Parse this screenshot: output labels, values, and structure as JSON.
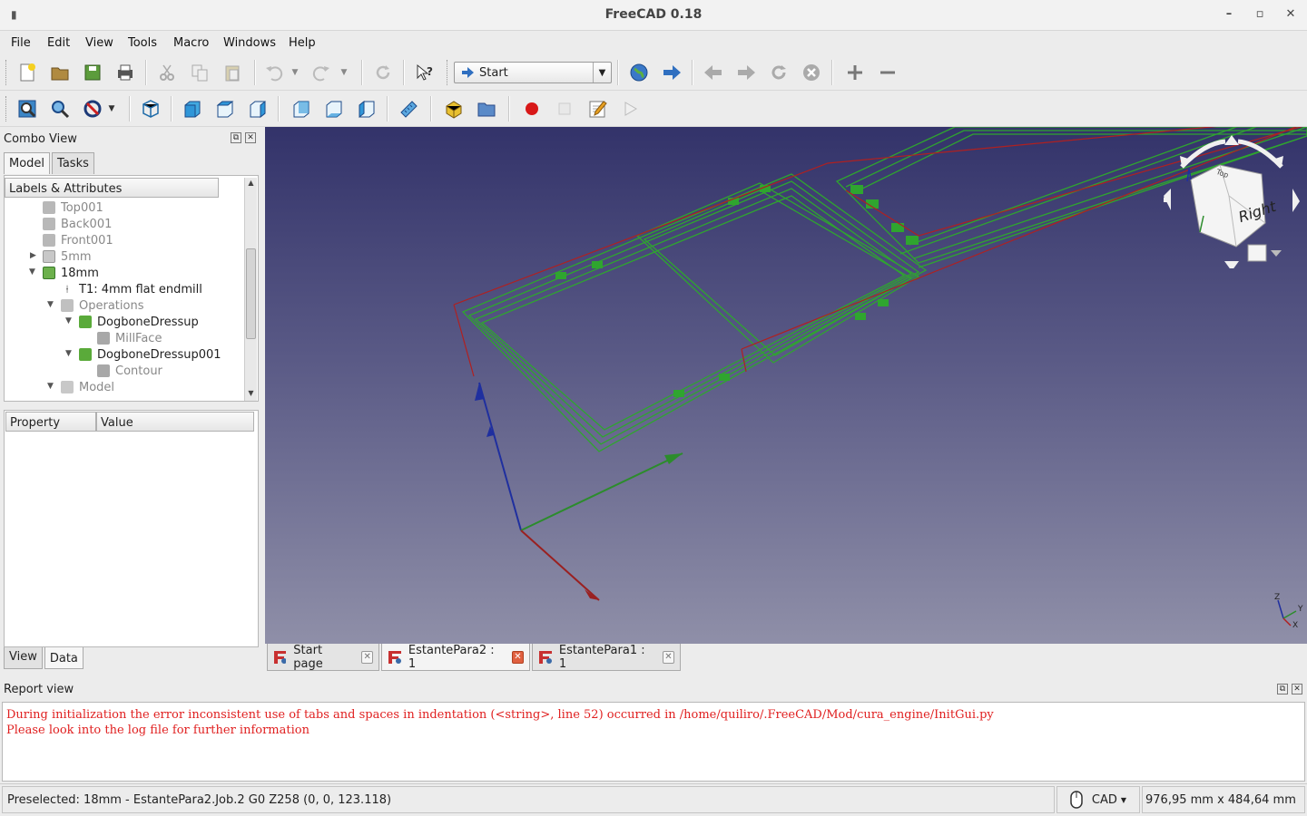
{
  "window": {
    "title": "FreeCAD 0.18"
  },
  "menu": [
    "File",
    "Edit",
    "View",
    "Tools",
    "Macro",
    "Windows",
    "Help"
  ],
  "workbench": {
    "selected": "Start"
  },
  "combo_view": {
    "title": "Combo View",
    "tabs": [
      "Model",
      "Tasks"
    ],
    "tree_header": "Labels & Attributes",
    "tree_items": [
      {
        "label": "Top001",
        "dim": true
      },
      {
        "label": "Back001",
        "dim": true
      },
      {
        "label": "Front001",
        "dim": true
      },
      {
        "label": "5mm",
        "dim": true
      },
      {
        "label": "18mm",
        "dim": false
      },
      {
        "label": "T1: 4mm flat endmill",
        "dim": false
      },
      {
        "label": "Operations",
        "dim": true
      },
      {
        "label": "DogboneDressup",
        "dim": false
      },
      {
        "label": "MillFace",
        "dim": true
      },
      {
        "label": "DogboneDressup001",
        "dim": false
      },
      {
        "label": "Contour",
        "dim": true
      },
      {
        "label": "Model",
        "dim": true
      }
    ],
    "property_headers": [
      "Property",
      "Value"
    ],
    "bottom_tabs": [
      "View",
      "Data"
    ]
  },
  "navcube": {
    "face_label": "Right",
    "top_label": "Top"
  },
  "doc_tabs": [
    {
      "label": "Start page",
      "active": false
    },
    {
      "label": "EstantePara2 : 1",
      "active": true
    },
    {
      "label": "EstantePara1 : 1",
      "active": false
    }
  ],
  "report": {
    "title": "Report view",
    "lines": [
      "During initialization the error inconsistent use of tabs and spaces in indentation (<string>, line 52) occurred in /home/quiliro/.FreeCAD/Mod/cura_engine/InitGui.py",
      "Please look into the log file for further information"
    ]
  },
  "status": {
    "message": "Preselected: 18mm - EstantePara2.Job.2 G0 Z258 (0, 0, 123.118)",
    "nav_style": "CAD",
    "dimensions": "976,95 mm x 484,64 mm"
  },
  "colors": {
    "toolpath_green": "#2fa52f",
    "path_red": "#b02020",
    "axis_blue": "#1f2f9f",
    "report_error": "#e02020"
  }
}
